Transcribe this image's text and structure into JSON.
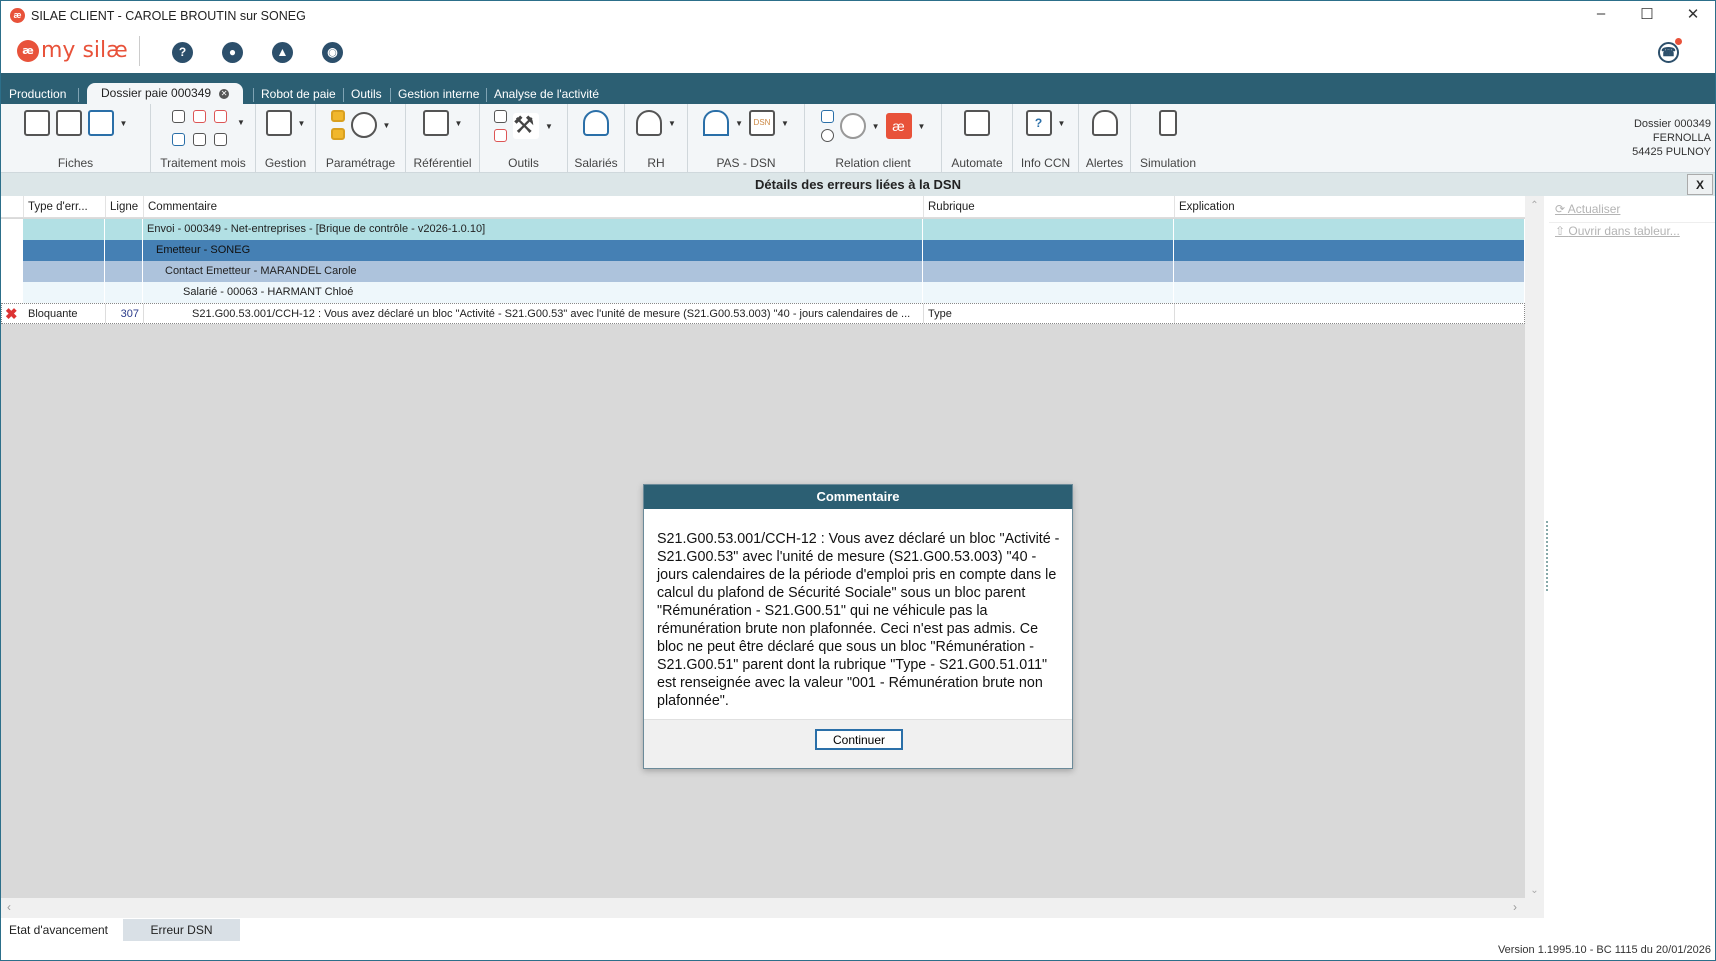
{
  "window": {
    "title": "SILAE CLIENT - CAROLE BROUTIN sur SONEG",
    "controls": [
      "minimize",
      "maximize",
      "close"
    ]
  },
  "logo": {
    "text": "my silæ",
    "mark": "æ"
  },
  "top_icons": [
    "help-icon",
    "community-icon",
    "academy-icon",
    "chat-icon",
    "support-icon"
  ],
  "tabs": [
    {
      "label": "Production"
    },
    {
      "label": "Dossier paie 000349",
      "active": true
    },
    {
      "label": "Robot de paie"
    },
    {
      "label": "Outils"
    },
    {
      "label": "Gestion interne"
    },
    {
      "label": "Analyse de l'activité"
    }
  ],
  "ribbon": {
    "groups": [
      {
        "label": "Fiches"
      },
      {
        "label": "Traitement mois"
      },
      {
        "label": "Gestion"
      },
      {
        "label": "Paramétrage"
      },
      {
        "label": "Référentiel"
      },
      {
        "label": "Outils"
      },
      {
        "label": "Salariés"
      },
      {
        "label": "RH"
      },
      {
        "label": "PAS - DSN"
      },
      {
        "label": "Relation client"
      },
      {
        "label": "Automate"
      },
      {
        "label": "Info CCN"
      },
      {
        "label": "Alertes"
      },
      {
        "label": "Simulation"
      }
    ],
    "dossier": {
      "line1": "Dossier 000349",
      "line2": "FERNOLLA",
      "line3": "54425 PULNOY"
    }
  },
  "panel": {
    "title": "Détails des erreurs liées à la DSN",
    "close": "X"
  },
  "grid": {
    "columns": [
      "Type d'err...",
      "Ligne",
      "Commentaire",
      "Rubrique",
      "Explication"
    ],
    "rows": [
      {
        "type": "",
        "ligne": "",
        "commentaire": "Envoi - 000349 - Net-entreprises - [Brique de contrôle - v2026-1.0.10]",
        "rubrique": "",
        "explication": ""
      },
      {
        "type": "",
        "ligne": "",
        "commentaire": "Emetteur - SONEG",
        "rubrique": "",
        "explication": ""
      },
      {
        "type": "",
        "ligne": "",
        "commentaire": "Contact Emetteur - MARANDEL Carole",
        "rubrique": "",
        "explication": ""
      },
      {
        "type": "",
        "ligne": "",
        "commentaire": "Salarié - 00063 - HARMANT Chloé",
        "rubrique": "",
        "explication": ""
      },
      {
        "type": "Bloquante",
        "ligne": "307",
        "commentaire": "S21.G00.53.001/CCH-12 : Vous avez déclaré un bloc \"Activité - S21.G00.53\" avec l'unité de mesure (S21.G00.53.003) \"40 - jours calendaires de ...",
        "rubrique": "Type",
        "explication": ""
      }
    ],
    "colors": {
      "envoi": "#b2e0e4",
      "emetteur": "#4580b4",
      "contact": "#adc3dc",
      "salarie": "#eef7fb"
    }
  },
  "side_actions": {
    "refresh": "Actualiser",
    "open_sheet": "Ouvrir dans tableur..."
  },
  "bottom_tabs": [
    "Etat d'avancement",
    "Erreur DSN"
  ],
  "status": "Version 1.1995.10 - BC 1115 du 20/01/2026",
  "modal": {
    "title": "Commentaire",
    "body": "S21.G00.53.001/CCH-12 : Vous avez déclaré un bloc \"Activité - S21.G00.53\" avec l'unité de mesure (S21.G00.53.003) \"40 - jours calendaires de la période d'emploi pris en compte dans le calcul du plafond de Sécurité Sociale\" sous un bloc parent \"Rémunération - S21.G00.51\" qui ne véhicule pas la rémunération brute non plafonnée. Ceci n'est pas admis. Ce bloc ne peut être déclaré que sous un bloc \"Rémunération - S21.G00.51\" parent dont la rubrique \"Type - S21.G00.51.011\" est renseignée avec la valeur \"001 - Rémunération brute non plafonnée\".",
    "button": "Continuer"
  }
}
